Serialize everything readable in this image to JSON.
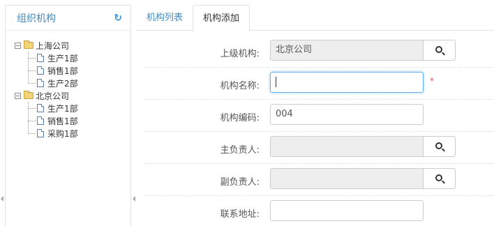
{
  "left_panel": {
    "title": "组织机构",
    "tree": [
      {
        "label": "上海公司",
        "children": [
          "生产1部",
          "销售1部",
          "生产2部"
        ]
      },
      {
        "label": "北京公司",
        "children": [
          "生产1部",
          "销售1部",
          "采购1部"
        ]
      }
    ]
  },
  "tabs": [
    {
      "label": "机构列表",
      "active": false
    },
    {
      "label": "机构添加",
      "active": true
    }
  ],
  "form": {
    "parent_org": {
      "label": "上级机构:",
      "value": "北京公司"
    },
    "org_name": {
      "label": "机构名称:",
      "value": "",
      "required_mark": "*"
    },
    "org_code": {
      "label": "机构编码:",
      "value": "004"
    },
    "primary_manager": {
      "label": "主负责人:",
      "value": ""
    },
    "deputy_manager": {
      "label": "副负责人:",
      "value": ""
    },
    "address": {
      "label": "联系地址:",
      "value": ""
    }
  },
  "colors": {
    "accent": "#3f8bc2",
    "required": "#d9534f",
    "focus": "#66afe9"
  }
}
